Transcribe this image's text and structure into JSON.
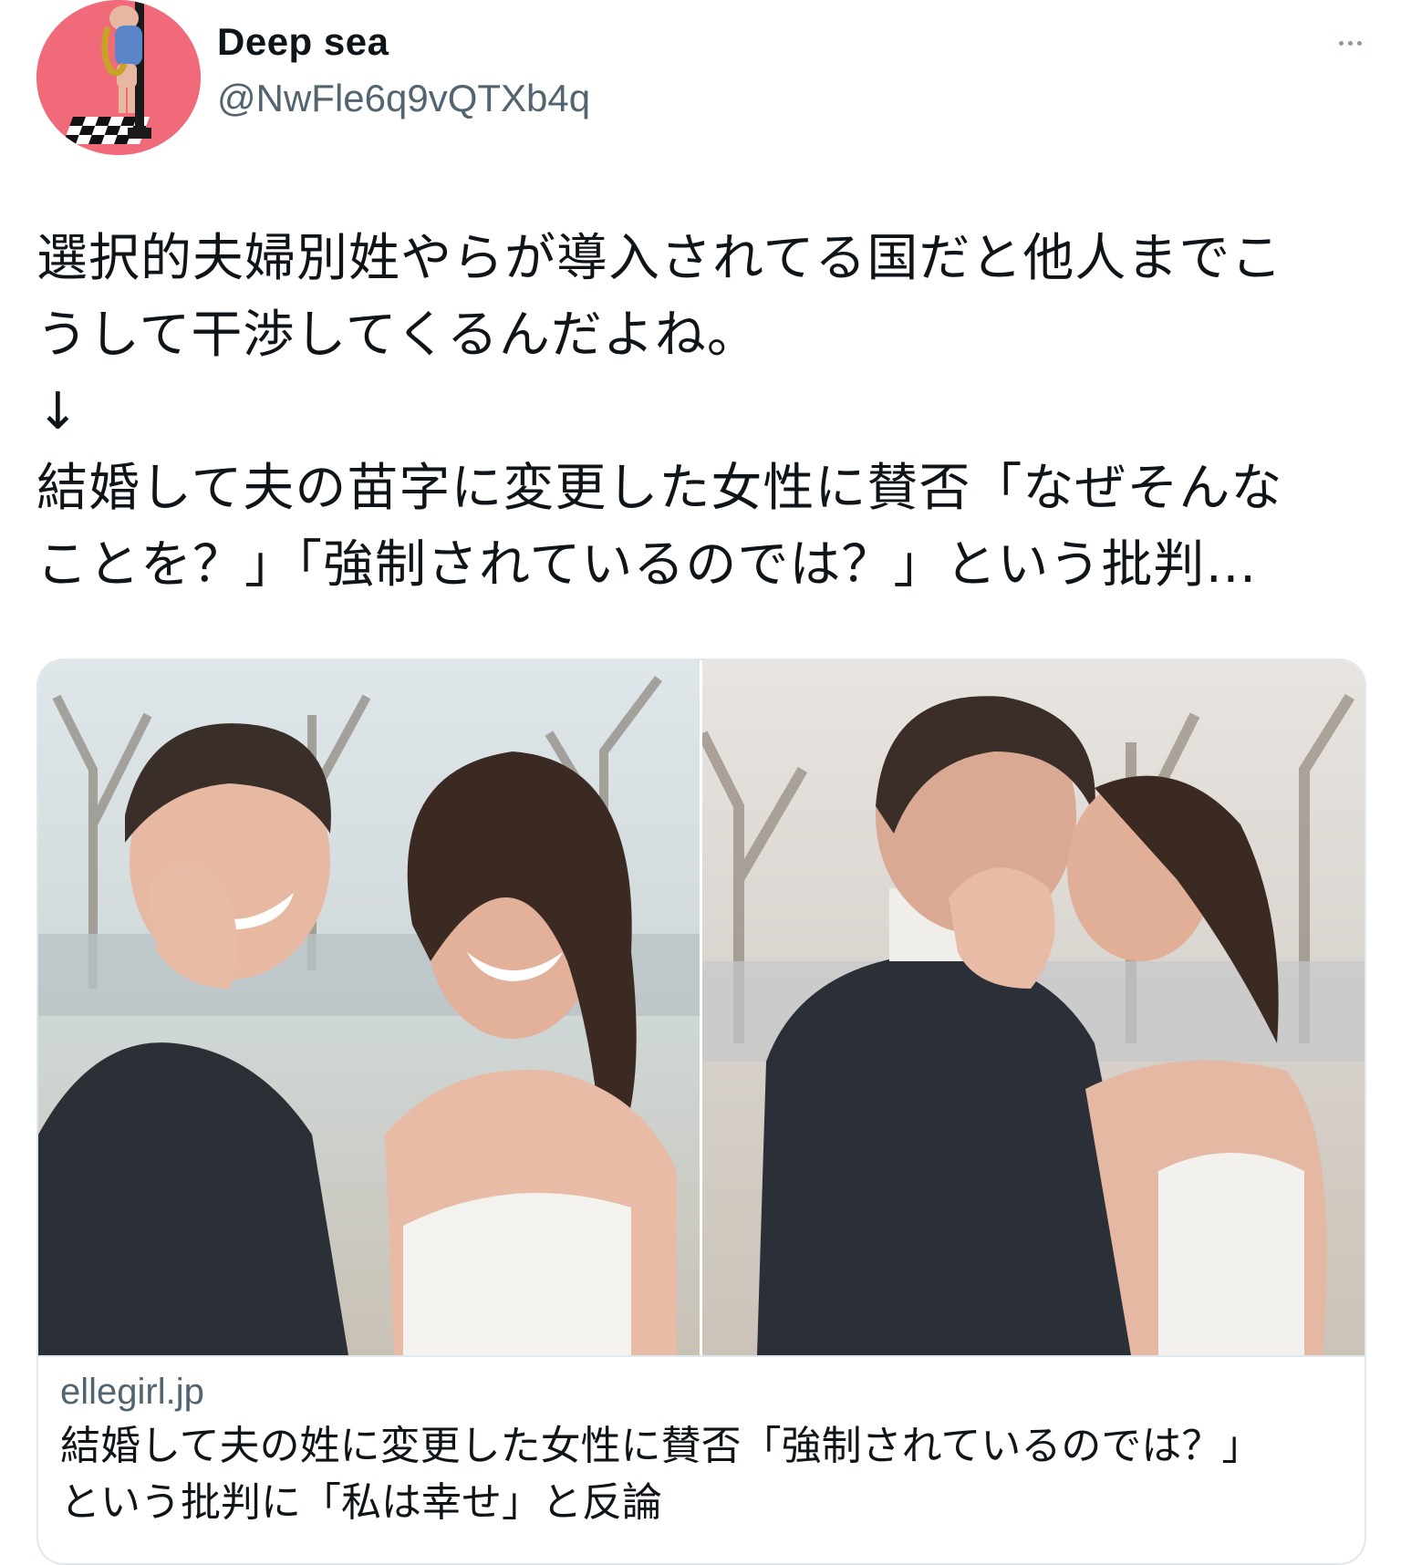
{
  "user": {
    "display_name": "Deep sea",
    "handle": "@NwFle6q9vQTXb4q",
    "avatar_icon": "cartoon-character-avatar",
    "avatar_bg": "#f06a7a"
  },
  "more_icon": "more-horizontal-icon",
  "tweet": {
    "lines": [
      "選択的夫婦別姓やらが導入されてる国だと他人までこ",
      "うして干渉してくるんだよね。",
      "↓",
      "結婚して夫の苗字に変更した女性に賛否「なぜそんな",
      "ことを？」「強制されているのでは？」という批判…"
    ]
  },
  "card": {
    "domain": "ellegirl.jp",
    "title_lines": [
      "結婚して夫の姓に変更した女性に賛否「強制されているのでは？」",
      "という批判に「私は幸せ」と反論"
    ]
  },
  "colors": {
    "text": "#0f1419",
    "secondary": "#536471",
    "border": "#e1e8ed"
  }
}
